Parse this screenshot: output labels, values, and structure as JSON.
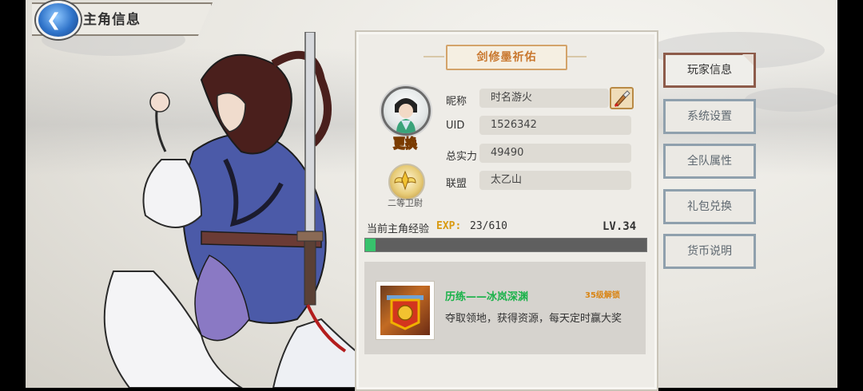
{
  "header": {
    "title": "主角信息"
  },
  "panel": {
    "title": "剑修墨祈佑",
    "avatar_action": "更换",
    "rank": "二等卫尉",
    "fields": [
      {
        "label": "昵称",
        "value": "时名游火"
      },
      {
        "label": "UID",
        "value": "1526342"
      },
      {
        "label": "总实力",
        "value": "49490"
      },
      {
        "label": "联盟",
        "value": "太乙山"
      }
    ],
    "exp": {
      "label": "当前主角经验",
      "tag": "EXP:",
      "value": "23/610",
      "progress": 0.038,
      "level": "LV.34"
    },
    "activity": {
      "title": "历练——冰岚深渊",
      "unlock": "35级解锁",
      "description": "夺取领地，获得资源，每天定时赢大奖"
    }
  },
  "side_menu": [
    {
      "label": "玩家信息",
      "active": true
    },
    {
      "label": "系统设置",
      "active": false
    },
    {
      "label": "全队属性",
      "active": false
    },
    {
      "label": "礼包兑换",
      "active": false
    },
    {
      "label": "货币说明",
      "active": false
    }
  ],
  "colors": {
    "exp_fill": "#37c26c",
    "active_tab_border": "#8d5b4a",
    "tab_border": "#8fa0ad",
    "activity_title": "#1bb24a",
    "panel_title": "#c9782f"
  }
}
